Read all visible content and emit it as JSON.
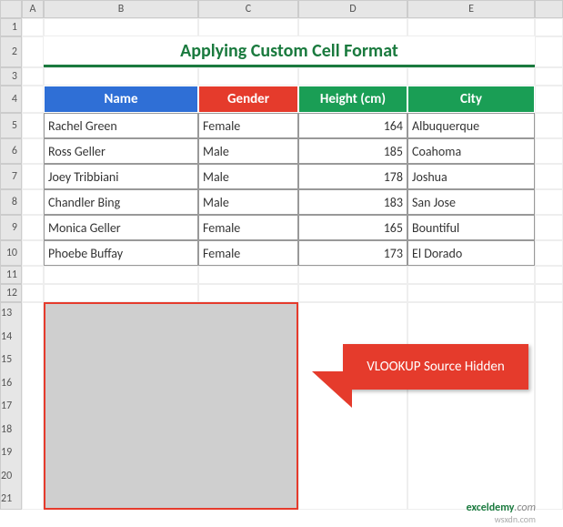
{
  "columns": [
    "A",
    "B",
    "C",
    "D",
    "E"
  ],
  "row_labels": [
    "1",
    "2",
    "3",
    "4",
    "5",
    "6",
    "7",
    "8",
    "9",
    "10",
    "11",
    "12",
    "13",
    "14",
    "15",
    "16",
    "17",
    "18",
    "19",
    "20",
    "21"
  ],
  "title": "Applying Custom Cell Format",
  "headers": {
    "name": "Name",
    "gender": "Gender",
    "height": "Height (cm)",
    "city": "City"
  },
  "rows": [
    {
      "name": "Rachel Green",
      "gender": "Female",
      "height": "164",
      "city": "Albuquerque"
    },
    {
      "name": "Ross Geller",
      "gender": "Male",
      "height": "185",
      "city": "Coahoma"
    },
    {
      "name": "Joey Tribbiani",
      "gender": "Male",
      "height": "178",
      "city": "Joshua"
    },
    {
      "name": "Chandler Bing",
      "gender": "Male",
      "height": "183",
      "city": "San Jose"
    },
    {
      "name": "Monica Geller",
      "gender": "Female",
      "height": "165",
      "city": "Bountiful"
    },
    {
      "name": "Phoebe Buffay",
      "gender": "Female",
      "height": "173",
      "city": "El Dorado"
    }
  ],
  "callout": "VLOOKUP Source Hidden",
  "watermark_brand": "exceldemy",
  "watermark_suffix": ".com",
  "watermark2": "wsxdn.com"
}
